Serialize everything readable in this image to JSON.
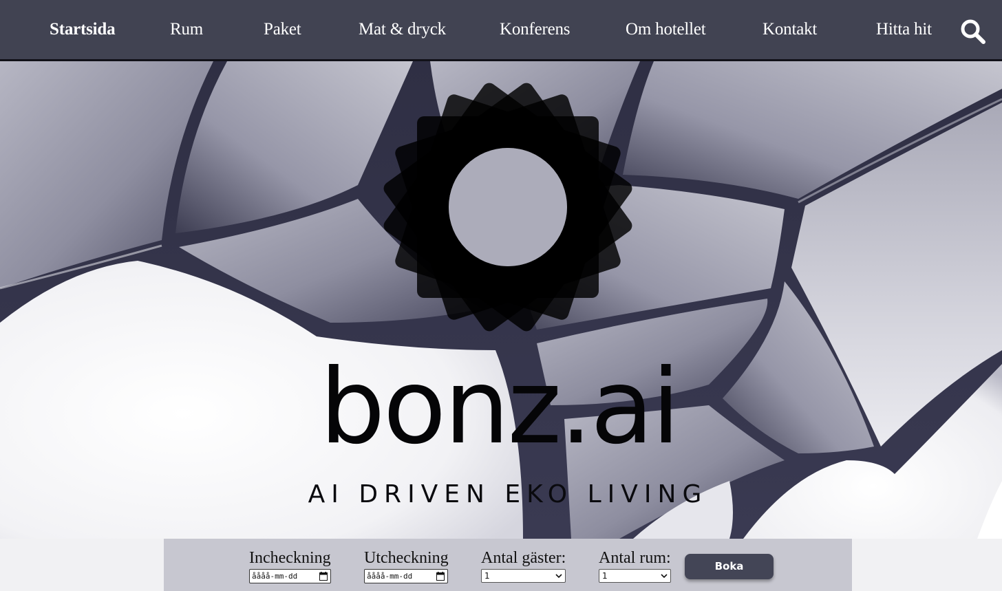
{
  "nav": {
    "items": [
      {
        "label": "Startsida",
        "active": true
      },
      {
        "label": "Rum",
        "active": false
      },
      {
        "label": "Paket",
        "active": false
      },
      {
        "label": "Mat & dryck",
        "active": false
      },
      {
        "label": "Konferens",
        "active": false
      },
      {
        "label": "Om hotellet",
        "active": false
      },
      {
        "label": "Kontakt",
        "active": false
      },
      {
        "label": "Hitta hit",
        "active": false
      }
    ],
    "search_icon": "search-icon"
  },
  "hero": {
    "brand": "bonz.ai",
    "tagline": "AI DRIVEN EKO LIVING",
    "emblem_icon": "rotated-squares-sun-logo"
  },
  "booking": {
    "checkin": {
      "label": "Incheckning",
      "value": "åååå-mm-dd"
    },
    "checkout": {
      "label": "Utcheckning",
      "value": "åååå-mm-dd"
    },
    "guests": {
      "label": "Antal gäster:",
      "selected": "1"
    },
    "rooms": {
      "label": "Antal rum:",
      "selected": "1"
    },
    "button_label": "Boka"
  },
  "colors": {
    "nav_bg": "#414352",
    "button_bg": "#434556",
    "booking_bg": "#c7c7d0",
    "page_bg": "#f1f1f3"
  }
}
